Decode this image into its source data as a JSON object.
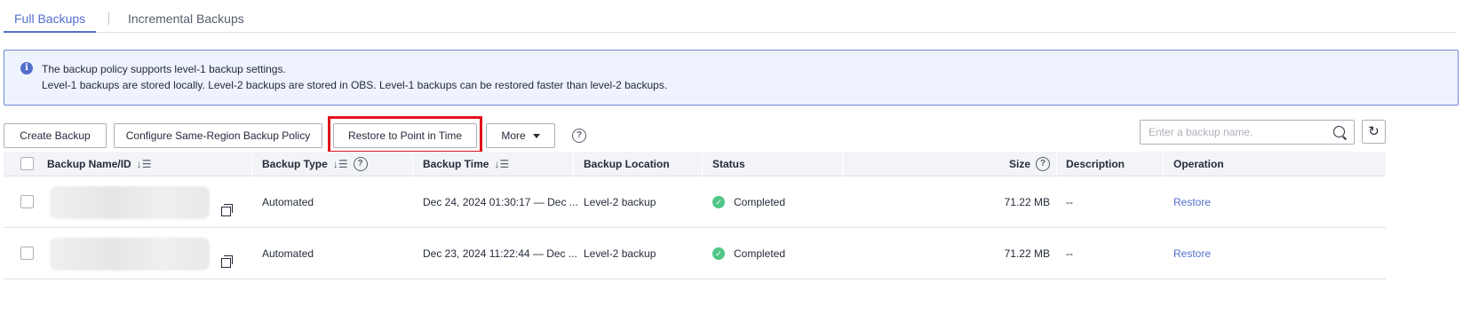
{
  "tabs": [
    {
      "label": "Full Backups",
      "active": true
    },
    {
      "label": "Incremental Backups",
      "active": false
    }
  ],
  "alert": {
    "line1": "The backup policy supports level-1 backup settings.",
    "line2": "Level-1 backups are stored locally. Level-2 backups are stored in OBS. Level-1 backups can be restored faster than level-2 backups."
  },
  "toolbar": {
    "create_label": "Create Backup",
    "config_label": "Configure Same-Region Backup Policy",
    "restore_label": "Restore to Point in Time",
    "more_label": "More",
    "help_glyph": "?",
    "search_placeholder": "Enter a backup name.",
    "refresh_glyph": "↻"
  },
  "table": {
    "headers": {
      "name": "Backup Name/ID",
      "type": "Backup Type",
      "time": "Backup Time",
      "location": "Backup Location",
      "status": "Status",
      "size": "Size",
      "description": "Description",
      "operation": "Operation"
    },
    "sort_glyph": "↓☰",
    "rows": [
      {
        "type": "Automated",
        "time": "Dec 24, 2024 01:30:17 — Dec ...",
        "location": "Level-2 backup",
        "status": "Completed",
        "size": "71.22 MB",
        "description": "--",
        "operation": "Restore"
      },
      {
        "type": "Automated",
        "time": "Dec 23, 2024 11:22:44 — Dec ...",
        "location": "Level-2 backup",
        "status": "Completed",
        "size": "71.22 MB",
        "description": "--",
        "operation": "Restore"
      }
    ]
  },
  "colors": {
    "accent": "#526ecc",
    "highlight": "#e0131d",
    "success": "#50c788"
  }
}
